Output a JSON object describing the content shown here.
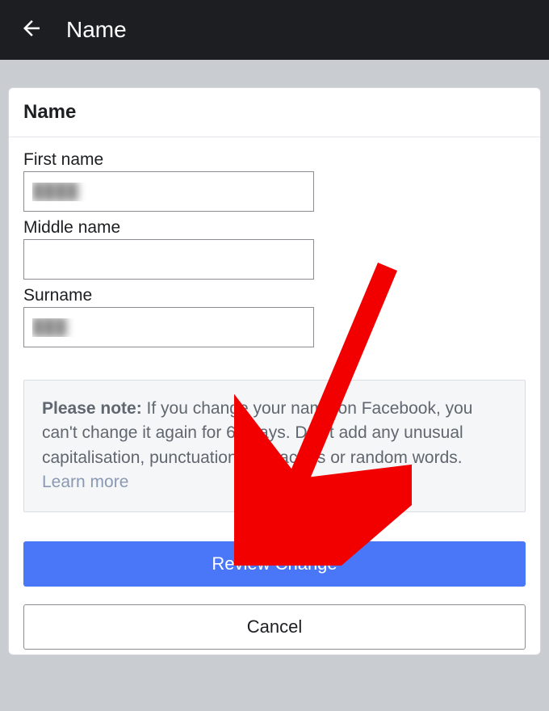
{
  "header": {
    "title": "Name"
  },
  "card": {
    "title": "Name"
  },
  "form": {
    "first_name": {
      "label": "First name",
      "value": "████"
    },
    "middle_name": {
      "label": "Middle name",
      "value": ""
    },
    "surname": {
      "label": "Surname",
      "value": "███"
    }
  },
  "note": {
    "strong": "Please note:",
    "body": " If you change your name on Facebook, you can't change it again for 60 days. Don't add any unusual capitalisation, punctuation, characters or random words. ",
    "learn_more": "Learn more"
  },
  "buttons": {
    "review": "Review Change",
    "cancel": "Cancel"
  },
  "colors": {
    "primary": "#4a76f8",
    "topbar": "#1c1e21",
    "arrow": "#f20000"
  }
}
